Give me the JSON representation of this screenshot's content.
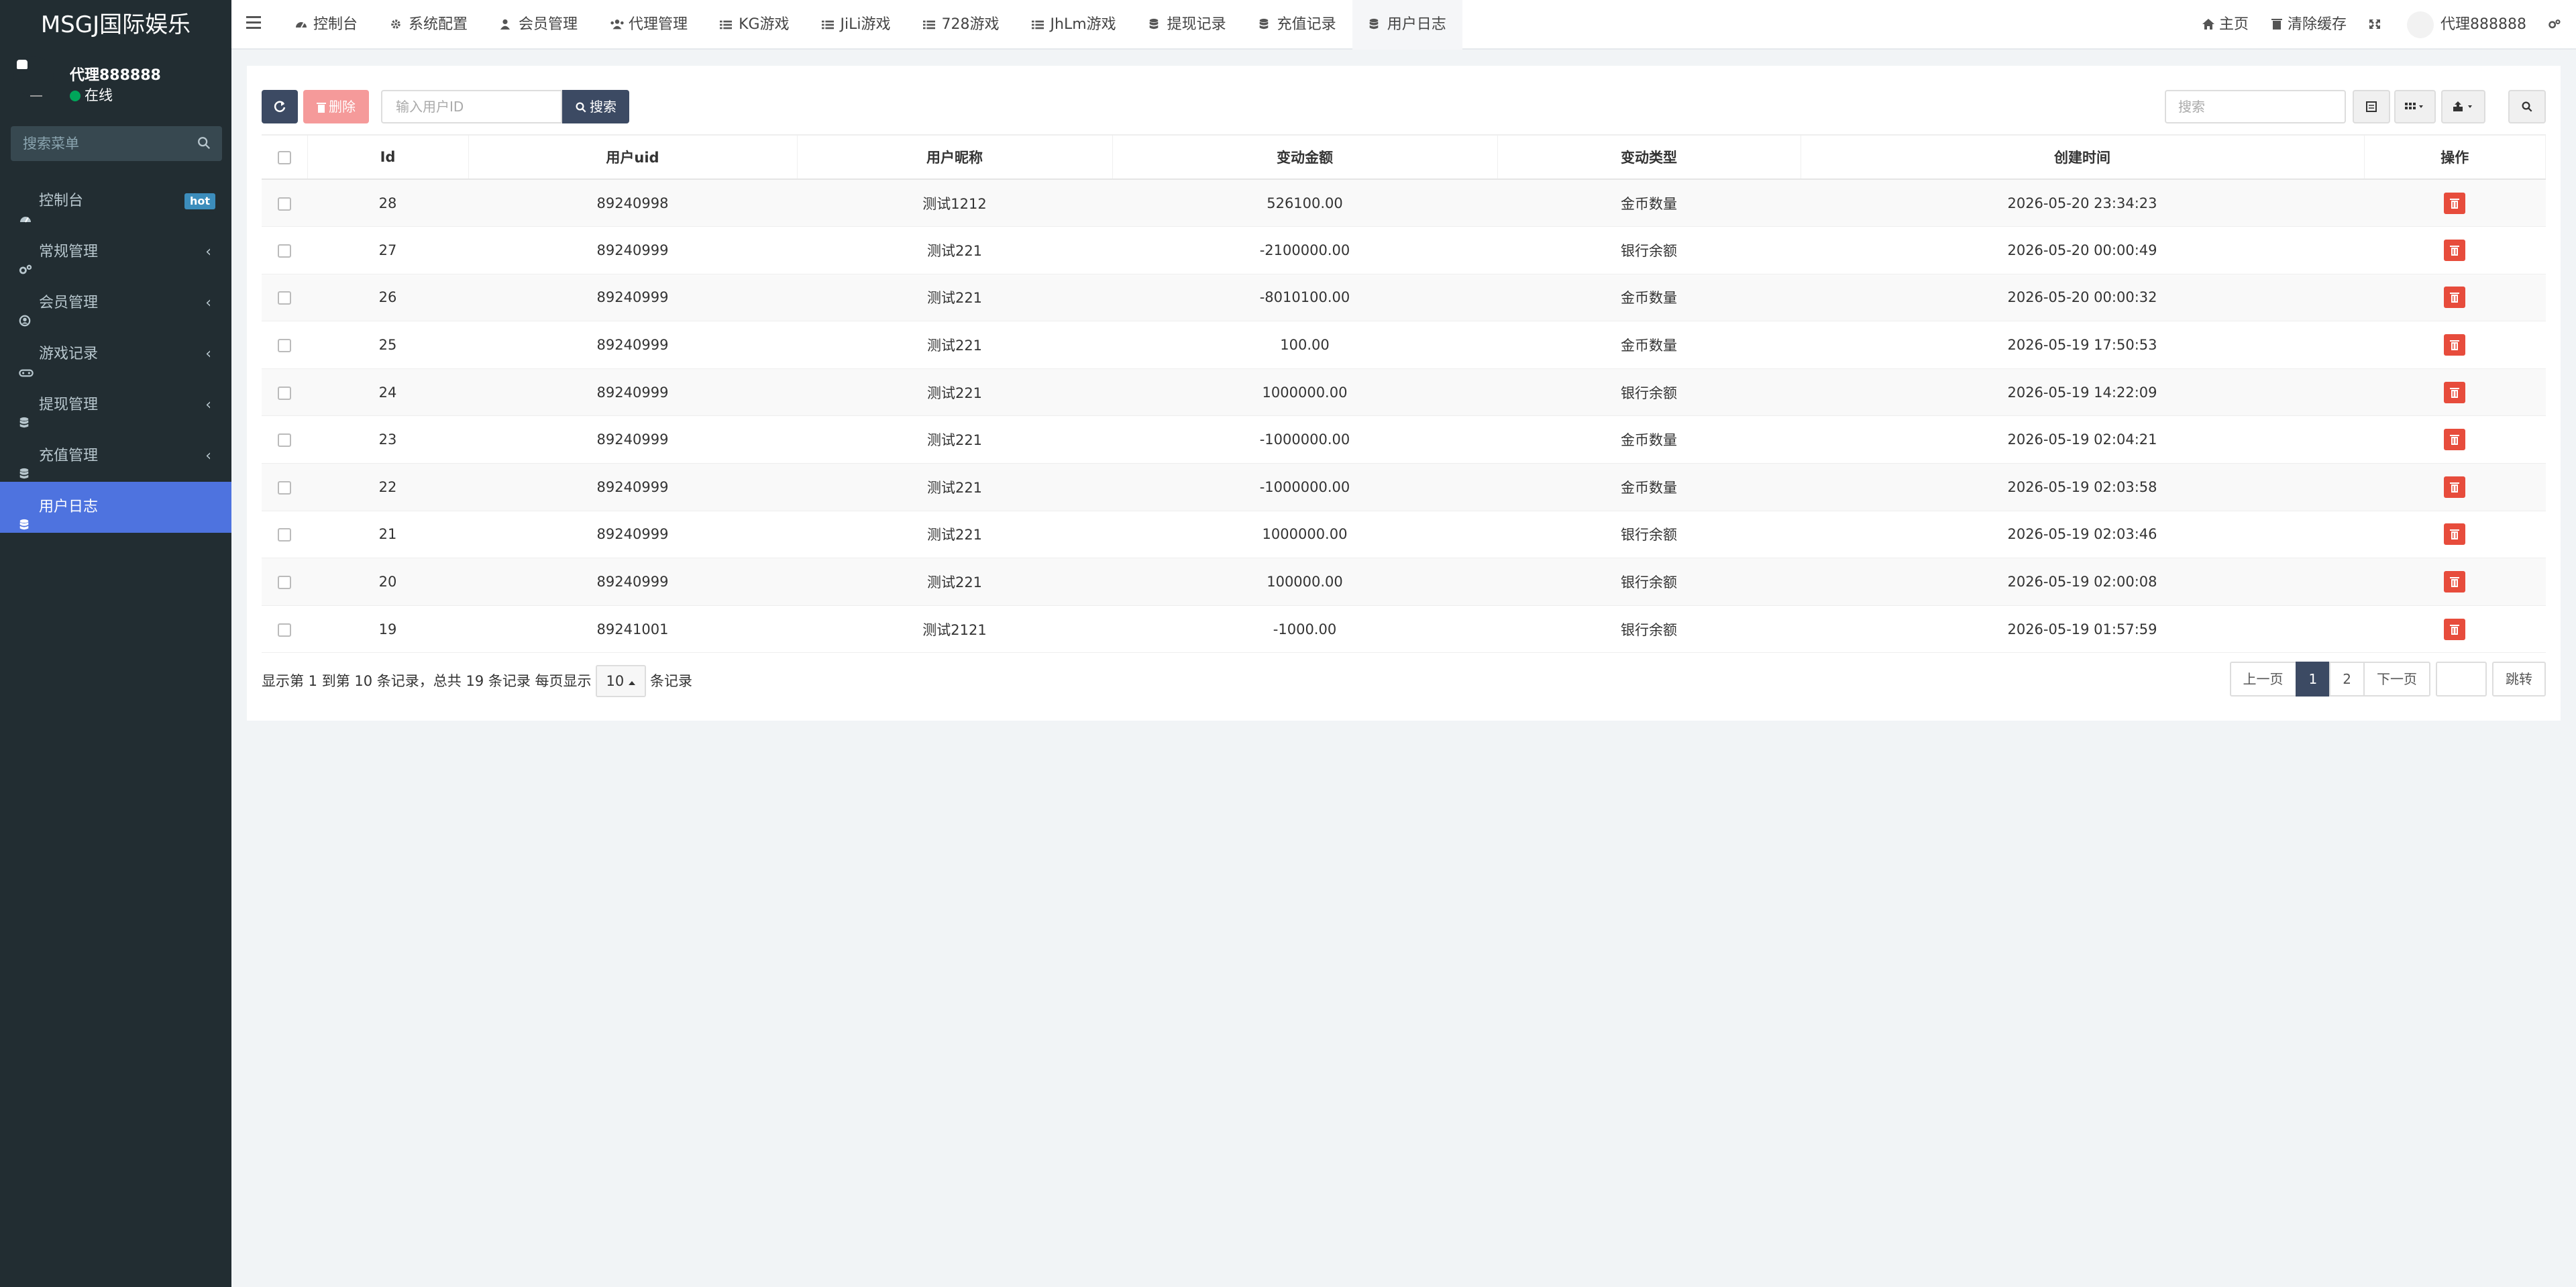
{
  "app": {
    "title": "MSGJ国际娱乐"
  },
  "user": {
    "name": "代理888888",
    "status": "在线"
  },
  "sidebar": {
    "search_placeholder": "搜索菜单",
    "items": [
      {
        "label": "控制台",
        "icon": "dashboard-icon",
        "badge": "hot"
      },
      {
        "label": "常规管理",
        "icon": "cogs-icon",
        "arrow": "‹"
      },
      {
        "label": "会员管理",
        "icon": "user-circle-icon",
        "arrow": "‹"
      },
      {
        "label": "游戏记录",
        "icon": "gamepad-icon",
        "arrow": "‹"
      },
      {
        "label": "提现管理",
        "icon": "database-icon",
        "arrow": "‹"
      },
      {
        "label": "充值管理",
        "icon": "database-icon",
        "arrow": "‹"
      },
      {
        "label": "用户日志",
        "icon": "database-icon",
        "active": true
      }
    ]
  },
  "topbar": {
    "tabs": [
      {
        "label": "控制台",
        "icon": "dashboard-icon"
      },
      {
        "label": "系统配置",
        "icon": "gear-icon"
      },
      {
        "label": "会员管理",
        "icon": "user-icon"
      },
      {
        "label": "代理管理",
        "icon": "users-icon"
      },
      {
        "label": "KG游戏",
        "icon": "list-icon"
      },
      {
        "label": "JiLi游戏",
        "icon": "list-icon"
      },
      {
        "label": "728游戏",
        "icon": "list-icon"
      },
      {
        "label": "JhLm游戏",
        "icon": "list-icon"
      },
      {
        "label": "提现记录",
        "icon": "database-icon"
      },
      {
        "label": "充值记录",
        "icon": "database-icon"
      },
      {
        "label": "用户日志",
        "icon": "database-icon",
        "active": true
      }
    ],
    "right": {
      "home": "主页",
      "clear_cache": "清除缓存",
      "user": "代理888888"
    }
  },
  "toolbar": {
    "delete_label": "删除",
    "uid_placeholder": "输入用户ID",
    "search_label": "搜索",
    "quick_search_placeholder": "搜索"
  },
  "table": {
    "columns": [
      "Id",
      "用户uid",
      "用户昵称",
      "变动金额",
      "变动类型",
      "创建时间",
      "操作"
    ],
    "rows": [
      {
        "id": "28",
        "uid": "89240998",
        "nick": "测试1212",
        "amount": "526100.00",
        "type": "金币数量",
        "kind": "coin",
        "time": "2026-05-20 23:34:23"
      },
      {
        "id": "27",
        "uid": "89240999",
        "nick": "测试221",
        "amount": "-2100000.00",
        "type": "银行余额",
        "kind": "bank",
        "time": "2026-05-20 00:00:49"
      },
      {
        "id": "26",
        "uid": "89240999",
        "nick": "测试221",
        "amount": "-8010100.00",
        "type": "金币数量",
        "kind": "coin",
        "time": "2026-05-20 00:00:32"
      },
      {
        "id": "25",
        "uid": "89240999",
        "nick": "测试221",
        "amount": "100.00",
        "type": "金币数量",
        "kind": "coin",
        "time": "2026-05-19 17:50:53"
      },
      {
        "id": "24",
        "uid": "89240999",
        "nick": "测试221",
        "amount": "1000000.00",
        "type": "银行余额",
        "kind": "bank",
        "time": "2026-05-19 14:22:09"
      },
      {
        "id": "23",
        "uid": "89240999",
        "nick": "测试221",
        "amount": "-1000000.00",
        "type": "金币数量",
        "kind": "coin",
        "time": "2026-05-19 02:04:21"
      },
      {
        "id": "22",
        "uid": "89240999",
        "nick": "测试221",
        "amount": "-1000000.00",
        "type": "金币数量",
        "kind": "coin",
        "time": "2026-05-19 02:03:58"
      },
      {
        "id": "21",
        "uid": "89240999",
        "nick": "测试221",
        "amount": "1000000.00",
        "type": "银行余额",
        "kind": "bank",
        "time": "2026-05-19 02:03:46"
      },
      {
        "id": "20",
        "uid": "89240999",
        "nick": "测试221",
        "amount": "100000.00",
        "type": "银行余额",
        "kind": "bank",
        "time": "2026-05-19 02:00:08"
      },
      {
        "id": "19",
        "uid": "89241001",
        "nick": "测试2121",
        "amount": "-1000.00",
        "type": "银行余额",
        "kind": "bank",
        "time": "2026-05-19 01:57:59"
      }
    ]
  },
  "pagination": {
    "info_prefix": "显示第 1 到第 10 条记录，总共 19 条记录 每页显示",
    "page_size": "10",
    "info_suffix": "条记录",
    "prev": "上一页",
    "pages": [
      "1",
      "2"
    ],
    "next": "下一页",
    "goto": "跳转"
  },
  "colors": {
    "sidebar_bg": "#222d32",
    "active": "#4e73df",
    "primary_btn": "#3c4a63",
    "danger": "#e74c3c",
    "bank_text": "#18bc9c"
  }
}
